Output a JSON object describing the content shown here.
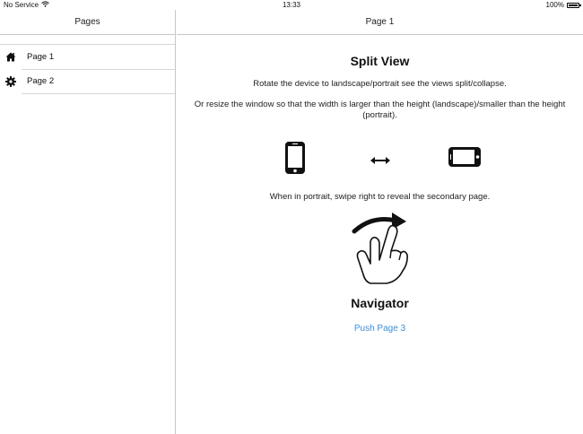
{
  "status_bar": {
    "carrier": "No Service",
    "time": "13:33",
    "battery": "100%"
  },
  "sidebar": {
    "title": "Pages",
    "items": [
      {
        "label": "Page 1",
        "icon": "home-icon"
      },
      {
        "label": "Page 2",
        "icon": "gear-icon"
      }
    ]
  },
  "main": {
    "header_title": "Page 1",
    "heading": "Split View",
    "paragraph1": "Rotate the device to landscape/portrait see the views split/collapse.",
    "paragraph2": "Or resize the window so that the width is larger than the height (landscape)/smaller than the height (portrait).",
    "paragraph3": "When in portrait, swipe right to reveal the secondary page.",
    "navigator_title": "Navigator",
    "push_link": "Push Page 3"
  },
  "colors": {
    "link": "#3a8fd8",
    "separator": "#c8c8cc"
  }
}
